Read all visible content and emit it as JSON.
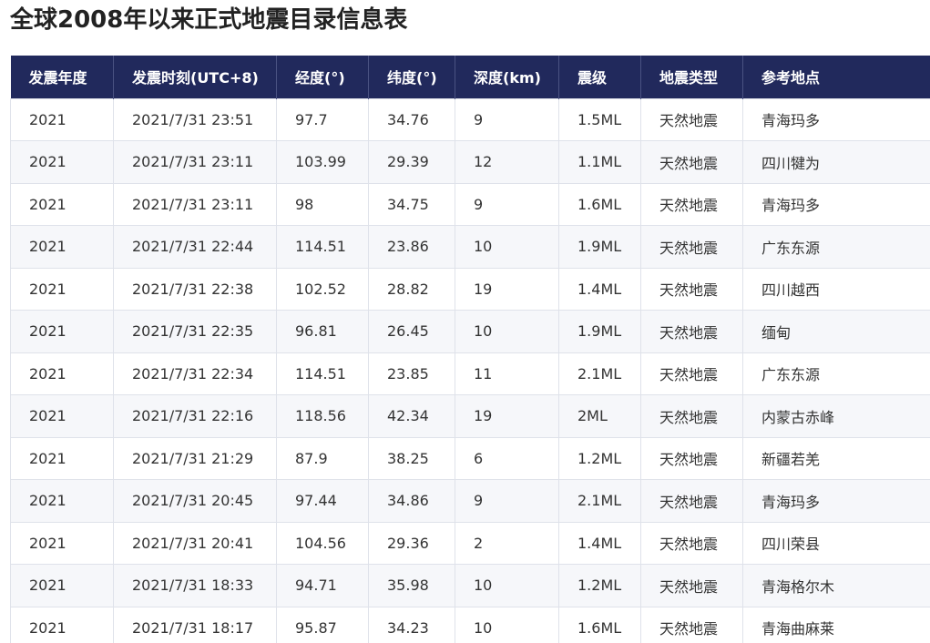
{
  "page": {
    "title": "全球2008年以来正式地震目录信息表"
  },
  "table": {
    "columns": [
      "发震年度",
      "发震时刻(UTC+8)",
      "经度(°)",
      "纬度(°)",
      "深度(km)",
      "震级",
      "地震类型",
      "参考地点"
    ],
    "rows": [
      [
        "2021",
        "2021/7/31 23:51",
        "97.7",
        "34.76",
        "9",
        "1.5ML",
        "天然地震",
        "青海玛多"
      ],
      [
        "2021",
        "2021/7/31 23:11",
        "103.99",
        "29.39",
        "12",
        "1.1ML",
        "天然地震",
        "四川犍为"
      ],
      [
        "2021",
        "2021/7/31 23:11",
        "98",
        "34.75",
        "9",
        "1.6ML",
        "天然地震",
        "青海玛多"
      ],
      [
        "2021",
        "2021/7/31 22:44",
        "114.51",
        "23.86",
        "10",
        "1.9ML",
        "天然地震",
        "广东东源"
      ],
      [
        "2021",
        "2021/7/31 22:38",
        "102.52",
        "28.82",
        "19",
        "1.4ML",
        "天然地震",
        "四川越西"
      ],
      [
        "2021",
        "2021/7/31 22:35",
        "96.81",
        "26.45",
        "10",
        "1.9ML",
        "天然地震",
        "缅甸"
      ],
      [
        "2021",
        "2021/7/31 22:34",
        "114.51",
        "23.85",
        "11",
        "2.1ML",
        "天然地震",
        "广东东源"
      ],
      [
        "2021",
        "2021/7/31 22:16",
        "118.56",
        "42.34",
        "19",
        "2ML",
        "天然地震",
        "内蒙古赤峰"
      ],
      [
        "2021",
        "2021/7/31 21:29",
        "87.9",
        "38.25",
        "6",
        "1.2ML",
        "天然地震",
        "新疆若羌"
      ],
      [
        "2021",
        "2021/7/31 20:45",
        "97.44",
        "34.86",
        "9",
        "2.1ML",
        "天然地震",
        "青海玛多"
      ],
      [
        "2021",
        "2021/7/31 20:41",
        "104.56",
        "29.36",
        "2",
        "1.4ML",
        "天然地震",
        "四川荣县"
      ],
      [
        "2021",
        "2021/7/31 18:33",
        "94.71",
        "35.98",
        "10",
        "1.2ML",
        "天然地震",
        "青海格尔木"
      ],
      [
        "2021",
        "2021/7/31 18:17",
        "95.87",
        "34.23",
        "10",
        "1.6ML",
        "天然地震",
        "青海曲麻莱"
      ]
    ]
  },
  "colors": {
    "header_bg": "#21295c",
    "header_text": "#ffffff",
    "row_alt_bg": "#f6f7fa",
    "border": "#dfe2ea"
  }
}
